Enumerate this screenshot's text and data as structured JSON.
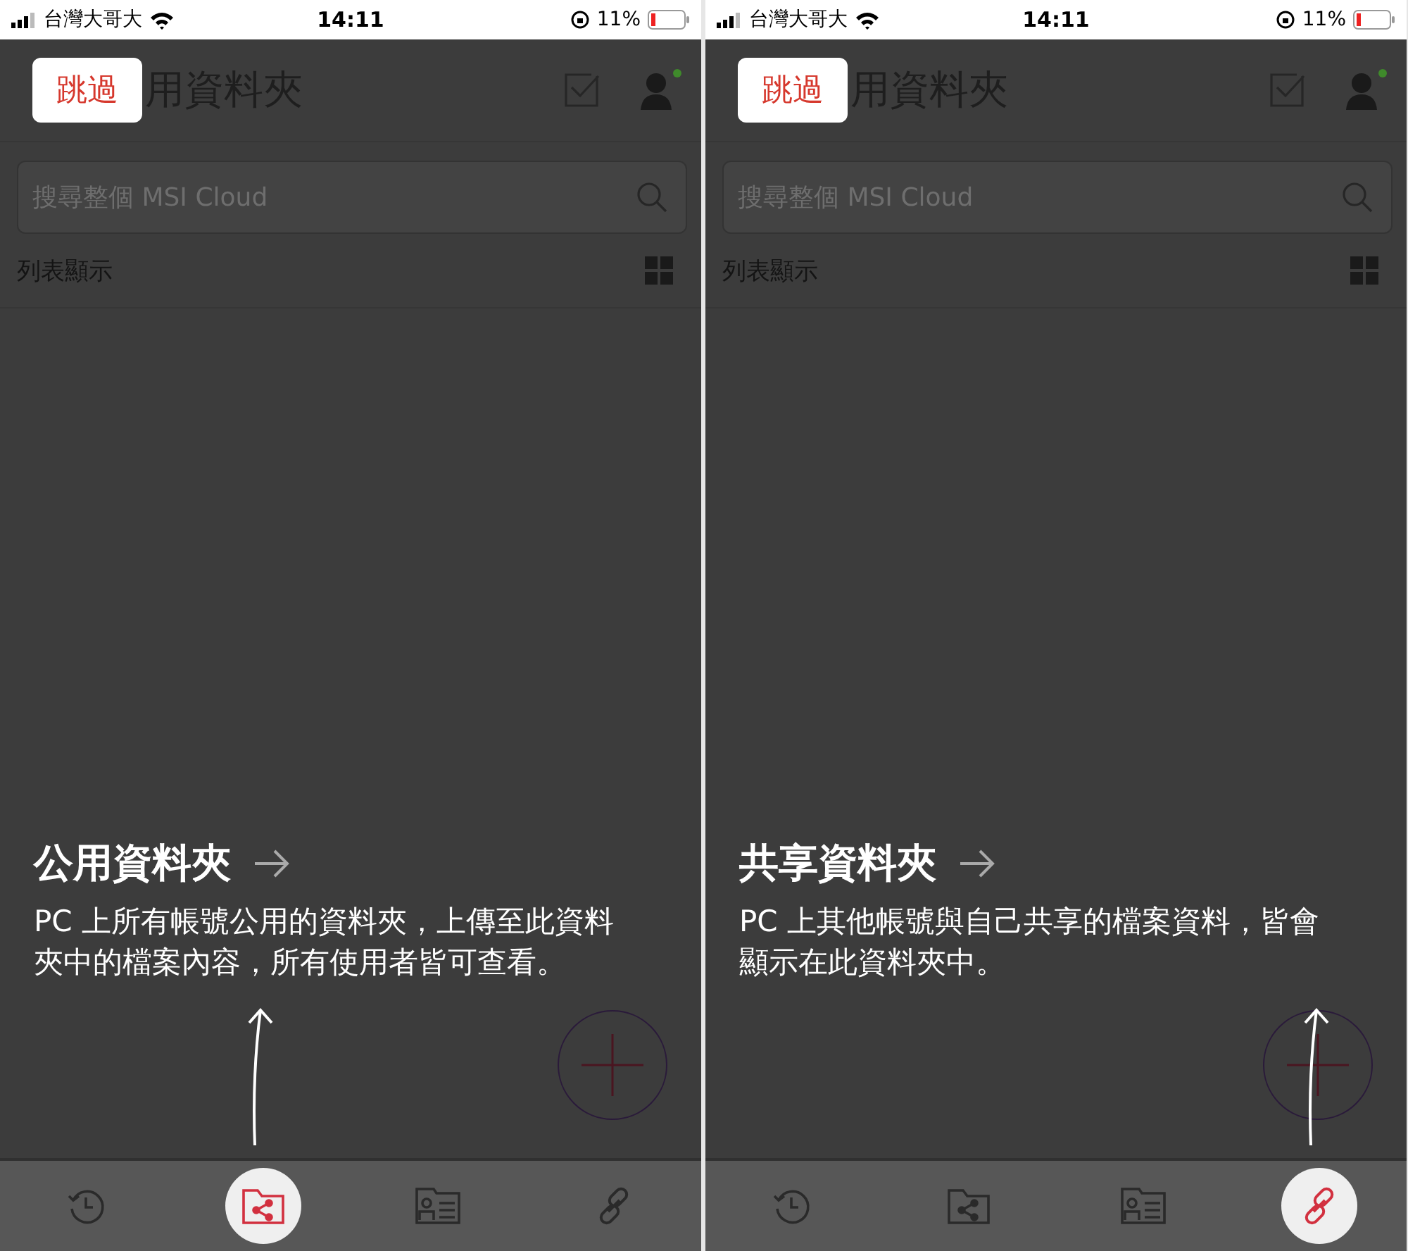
{
  "panels": [
    {
      "status_bar": {
        "carrier": "台灣大哥大",
        "time": "14:11",
        "battery": "11%"
      },
      "skip_button": "跳過",
      "title": "用資料夾",
      "search": {
        "placeholder": "搜尋整個 MSI Cloud"
      },
      "view_label": "列表顯示",
      "coach": {
        "title": "公用資料夾",
        "description": "PC 上所有帳號公用的資料夾，上傳至此資料夾中的檔案內容，所有使用者皆可查看。"
      },
      "tabs": [
        {
          "kind": "history",
          "selected": false
        },
        {
          "kind": "shared-folder",
          "selected": true
        },
        {
          "kind": "contacts",
          "selected": false
        },
        {
          "kind": "link",
          "selected": false
        }
      ]
    },
    {
      "status_bar": {
        "carrier": "台灣大哥大",
        "time": "14:11",
        "battery": "11%"
      },
      "skip_button": "跳過",
      "title": "用資料夾",
      "search": {
        "placeholder": "搜尋整個 MSI Cloud"
      },
      "view_label": "列表顯示",
      "coach": {
        "title": "共享資料夾",
        "description": "PC 上其他帳號與自己共享的檔案資料，皆會顯示在此資料夾中。"
      },
      "tabs": [
        {
          "kind": "history",
          "selected": false
        },
        {
          "kind": "shared-folder",
          "selected": false
        },
        {
          "kind": "contacts",
          "selected": false
        },
        {
          "kind": "link",
          "selected": true
        }
      ]
    }
  ]
}
